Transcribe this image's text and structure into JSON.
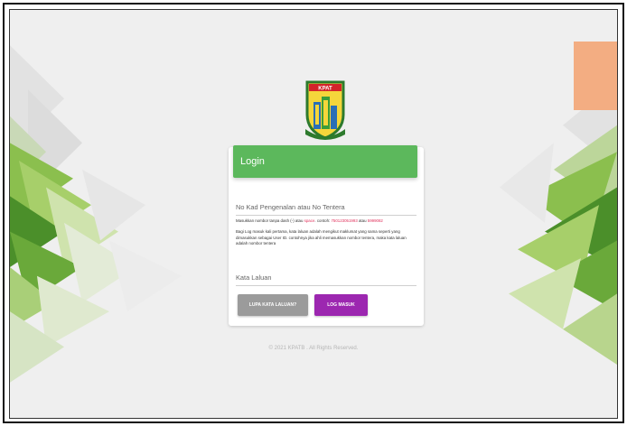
{
  "app": {
    "logo_text": "KPAT"
  },
  "login": {
    "title": "Login",
    "id_label": "No Kad Pengenalan atau No Tentera",
    "help_prefix": "Masukkan nombor tanpa dash (-) atau ",
    "help_example_word": "space",
    "help_middle": ". contoh: ",
    "help_example_ic": "750123051993",
    "help_or": " atau ",
    "help_example_army": "5999082",
    "help_paragraph": "Bagi Log masuk kali pertama, kata laluan adalah mengikut maklumat yang sama seperti yang dimasukkan sebagai User ID. contohnya jika ahli memasukkan nombor tentera, maka kata laluan adalah nombor tentera",
    "password_label": "Kata Laluan",
    "forgot_button": "LUPA KATA LALUAN?",
    "login_button": "LOG MASUK"
  },
  "footer": {
    "text": "© 2021 KPATB . All Rights Reserved."
  },
  "colors": {
    "header_green": "#5cb85c",
    "login_purple": "#9c27b0",
    "forgot_grey": "#9b9b9b",
    "corner_orange": "#f3ad82",
    "highlight_red": "#e0315b"
  }
}
